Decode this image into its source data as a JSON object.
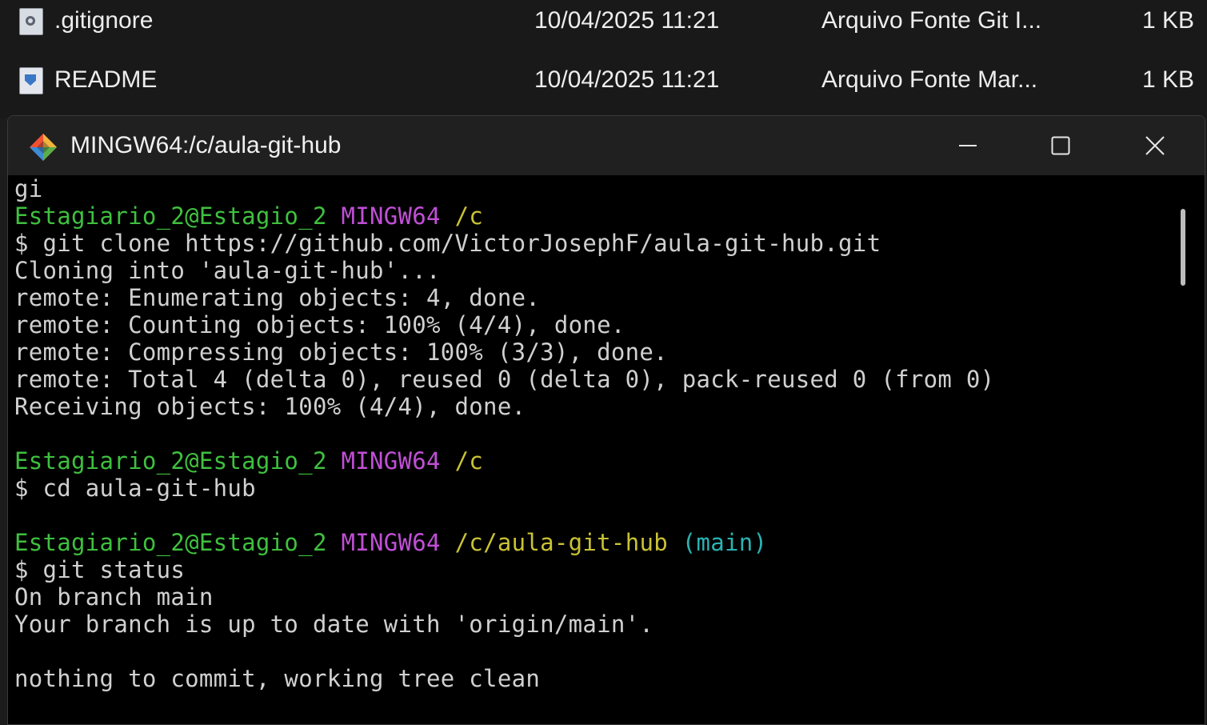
{
  "explorer": {
    "files": [
      {
        "name": ".gitignore",
        "modified": "10/04/2025 11:21",
        "type": "Arquivo Fonte Git I...",
        "size": "1 KB",
        "icon": "gear-file-icon"
      },
      {
        "name": "README",
        "modified": "10/04/2025 11:21",
        "type": "Arquivo Fonte Mar...",
        "size": "1 KB",
        "icon": "markdown-file-icon"
      }
    ]
  },
  "terminal": {
    "title": "MINGW64:/c/aula-git-hub",
    "icon": "git-diamond-icon",
    "lines": {
      "l01": "gi",
      "p1": {
        "user": "Estagiario_2@Estagio_2",
        "env": "MINGW64",
        "path": "/c"
      },
      "l03": "$ git clone https://github.com/VictorJosephF/aula-git-hub.git",
      "l04": "Cloning into 'aula-git-hub'...",
      "l05": "remote: Enumerating objects: 4, done.",
      "l06": "remote: Counting objects: 100% (4/4), done.",
      "l07": "remote: Compressing objects: 100% (3/3), done.",
      "l08": "remote: Total 4 (delta 0), reused 0 (delta 0), pack-reused 0 (from 0)",
      "l09": "Receiving objects: 100% (4/4), done.",
      "p2": {
        "user": "Estagiario_2@Estagio_2",
        "env": "MINGW64",
        "path": "/c"
      },
      "l12": "$ cd aula-git-hub",
      "p3": {
        "user": "Estagiario_2@Estagio_2",
        "env": "MINGW64",
        "path": "/c/aula-git-hub",
        "branch": "(main)"
      },
      "l15": "$ git status",
      "l16": "On branch main",
      "l17": "Your branch is up to date with 'origin/main'.",
      "l19": "nothing to commit, working tree clean"
    },
    "colors": {
      "user": "#3fc03f",
      "env": "#c14fd6",
      "path": "#c9c235",
      "branch": "#2ab3b3"
    }
  }
}
